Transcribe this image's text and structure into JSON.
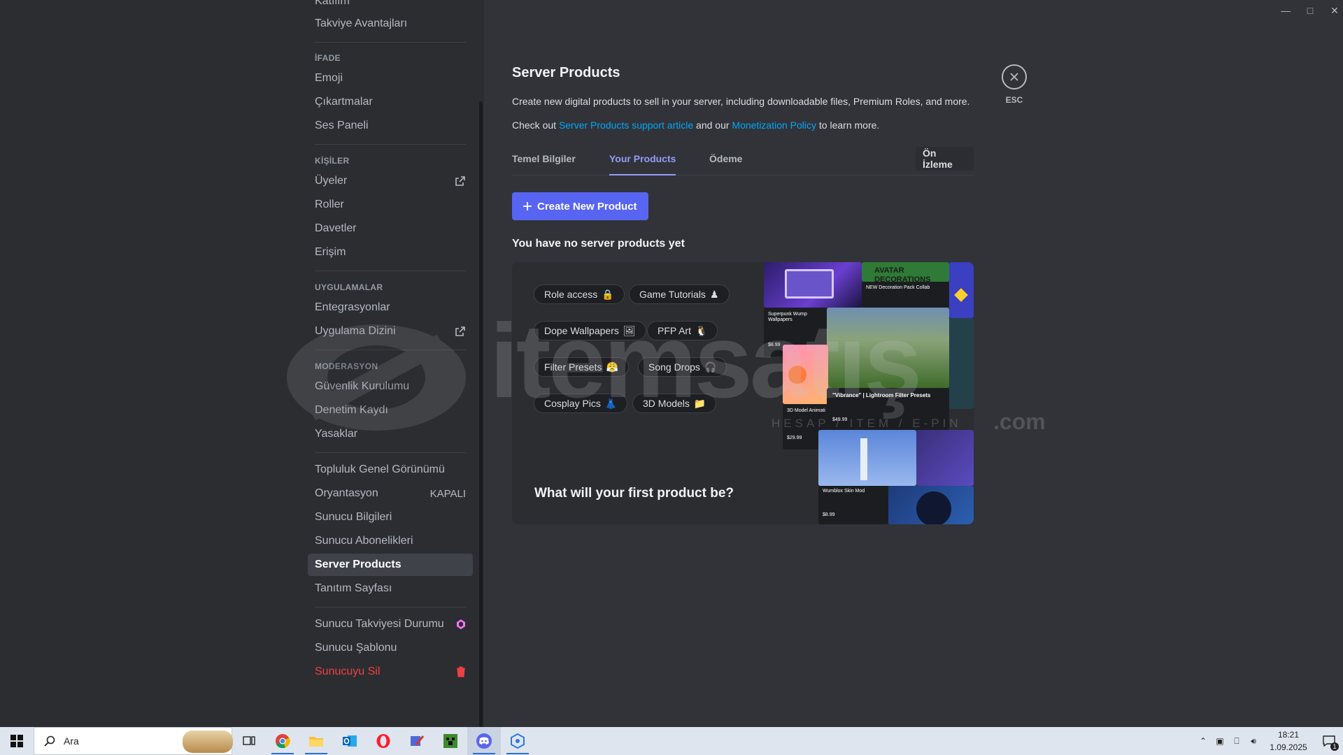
{
  "window": {
    "controls": [
      "minimize",
      "maximize",
      "close"
    ]
  },
  "sidebar": {
    "items_top": [
      {
        "label": "Katılım",
        "partial": true
      },
      {
        "label": "Takviye Avantajları"
      }
    ],
    "sections": [
      {
        "header": "İFADE",
        "items": [
          "Emoji",
          "Çıkartmalar",
          "Ses Paneli"
        ]
      },
      {
        "header": "KİŞİLER",
        "items": [
          "Üyeler",
          "Roller",
          "Davetler",
          "Erişim"
        ]
      },
      {
        "header": "UYGULAMALAR",
        "items": [
          "Entegrasyonlar",
          "Uygulama Dizini"
        ]
      },
      {
        "header": "MODERASYON",
        "items": [
          "Güvenlik Kurulumu",
          "Denetim Kaydı",
          "Yasaklar"
        ]
      }
    ],
    "community": {
      "items": [
        "Topluluk Genel Görünümü",
        "Oryantasyon",
        "Sunucu Bilgileri",
        "Sunucu Abonelikleri",
        "Server Products",
        "Tanıtım Sayfası"
      ],
      "orientation_status": "KAPALI",
      "active": "Server Products"
    },
    "bottom": {
      "items": [
        "Sunucu Takviyesi Durumu",
        "Sunucu Şablonu",
        "Sunucuyu Sil"
      ]
    }
  },
  "main": {
    "title": "Server Products",
    "description": "Create new digital products to sell in your server, including downloadable files, Premium Roles, and more.",
    "checkout": {
      "prefix": "Check out ",
      "link1": "Server Products support article",
      "middle": " and our ",
      "link2": "Monetization Policy",
      "suffix": " to learn more."
    },
    "close_label": "ESC",
    "tabs": [
      {
        "label": "Temel Bilgiler",
        "active": false
      },
      {
        "label": "Your Products",
        "active": true
      },
      {
        "label": "Ödeme",
        "active": false
      }
    ],
    "preview_label": "Ön İzleme",
    "create_button": "Create New Product",
    "empty_title": "You have no server products yet",
    "card": {
      "pills": [
        {
          "label": "Role access",
          "emoji": "🔒"
        },
        {
          "label": "Game Tutorials",
          "emoji": "♟"
        },
        {
          "label": "Dope Wallpapers",
          "emoji": "🖼"
        },
        {
          "label": "PFP Art",
          "emoji": "🐧"
        },
        {
          "label": "Filter Presets",
          "emoji": "😤"
        },
        {
          "label": "Song Drops",
          "emoji": "🎧"
        },
        {
          "label": "Cosplay Pics",
          "emoji": "👗"
        },
        {
          "label": "3D Models",
          "emoji": "📁"
        }
      ],
      "question": "What will your first product be?",
      "collage": {
        "avatar": "AVATAR DECORATIONS",
        "new_deco": "NEW Decoration Pack Collab",
        "wallpaper": "Superpunk Wump Wallpapers",
        "price_wallpaper": "$8.99",
        "vibrance": "\"Vibrance\" | Lightroom Filter Presets",
        "price_vibrance": "$49.99",
        "model": "3D Model Animati",
        "price_model": "$29.99",
        "skin": "Wumblox Skin Mod",
        "price_skin": "$8.99"
      }
    }
  },
  "watermark": {
    "brand": "itemsatış",
    "sub": "HESAP / ITEM / E-PIN",
    "domain": ".com"
  },
  "taskbar": {
    "search_placeholder": "Ara",
    "apps": [
      "task-view",
      "chrome",
      "file-explorer",
      "outlook",
      "opera",
      "app-pencil",
      "minecraft",
      "discord",
      "itemsatis"
    ],
    "time": "18:21",
    "date": "1.09.2025",
    "notif_count": "1"
  }
}
